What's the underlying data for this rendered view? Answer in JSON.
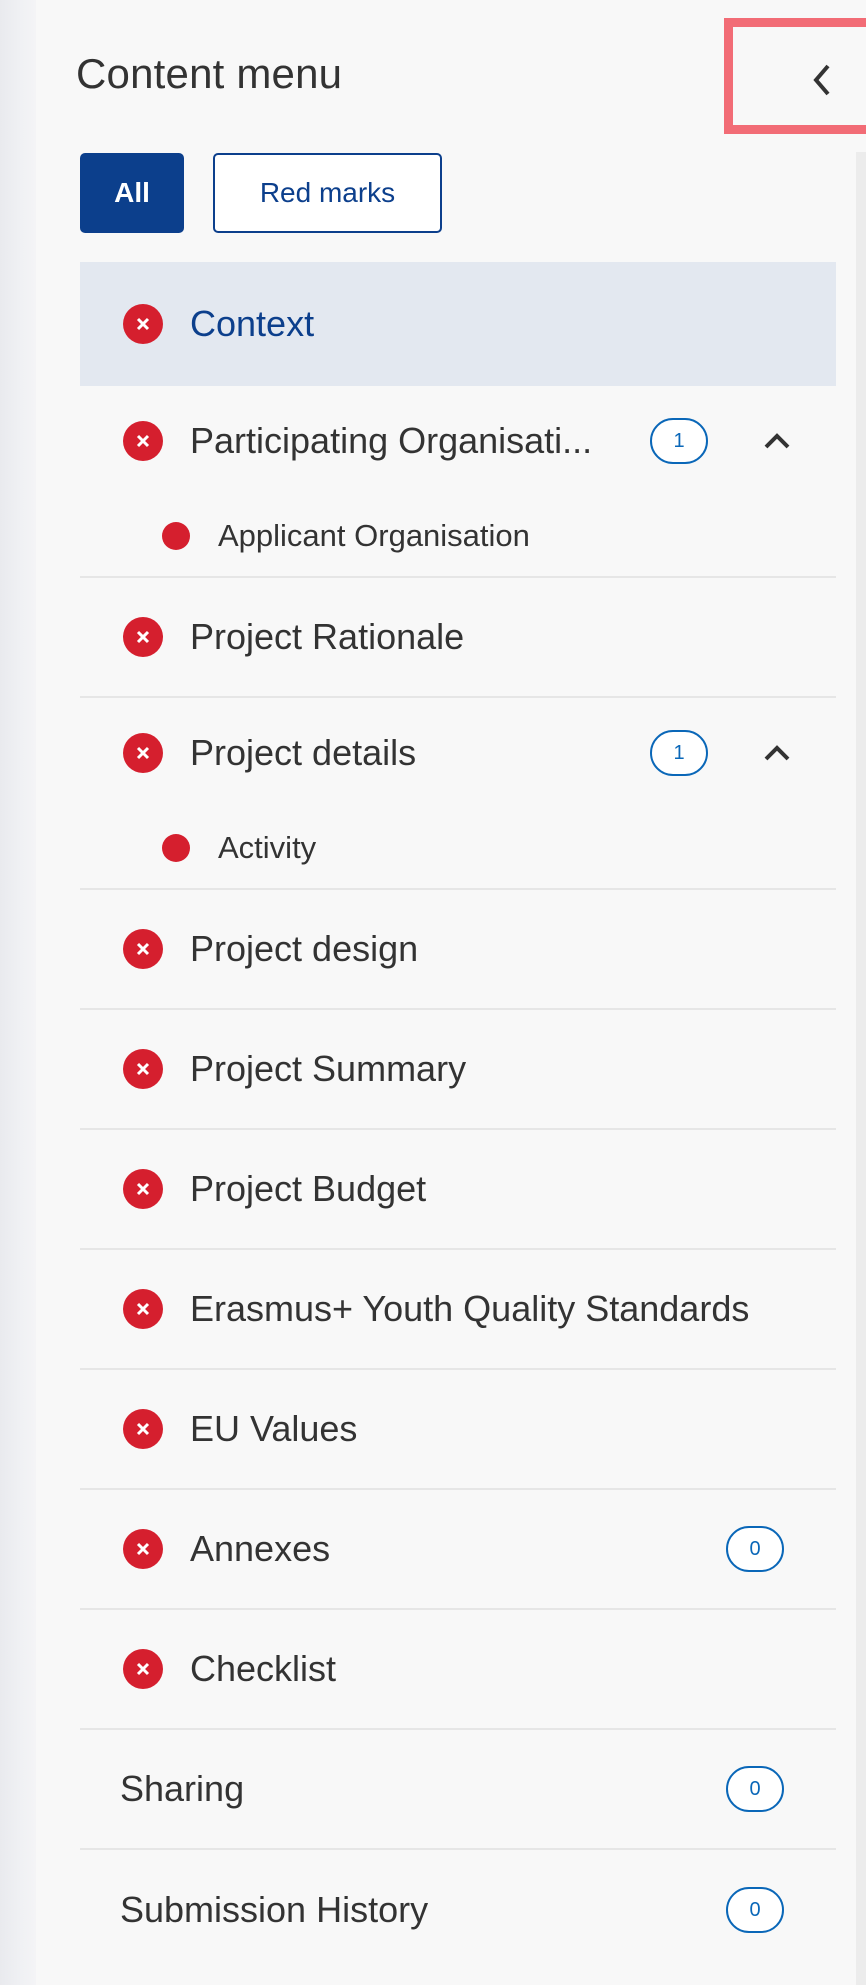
{
  "panel": {
    "title": "Content menu",
    "collapse_icon": "chevron-left-icon"
  },
  "filters": {
    "all_label": "All",
    "red_marks_label": "Red marks"
  },
  "menu": {
    "items": [
      {
        "label": "Context",
        "icon": "error-x-icon",
        "active": true
      },
      {
        "label": "Participating Organisati...",
        "icon": "error-x-icon",
        "badge": "1",
        "expanded": true,
        "children": [
          {
            "label": "Applicant Organisation",
            "icon": "red-dot-icon"
          }
        ]
      },
      {
        "label": "Project Rationale",
        "icon": "error-x-icon"
      },
      {
        "label": "Project details",
        "icon": "error-x-icon",
        "badge": "1",
        "expanded": true,
        "children": [
          {
            "label": "Activity",
            "icon": "red-dot-icon"
          }
        ]
      },
      {
        "label": "Project design",
        "icon": "error-x-icon"
      },
      {
        "label": "Project Summary",
        "icon": "error-x-icon"
      },
      {
        "label": "Project Budget",
        "icon": "error-x-icon"
      },
      {
        "label": "Erasmus+ Youth Quality Standards",
        "icon": "error-x-icon"
      },
      {
        "label": "EU Values",
        "icon": "error-x-icon"
      },
      {
        "label": "Annexes",
        "icon": "error-x-icon",
        "badge": "0"
      },
      {
        "label": "Checklist",
        "icon": "error-x-icon"
      },
      {
        "label": "Sharing",
        "badge": "0"
      },
      {
        "label": "Submission History",
        "badge": "0"
      }
    ]
  },
  "colors": {
    "primary": "#0c3f8c",
    "badge_blue": "#0a67b8",
    "error_red": "#d51f2e",
    "highlight_border": "#f26c76",
    "active_bg": "#e3e8f0"
  }
}
